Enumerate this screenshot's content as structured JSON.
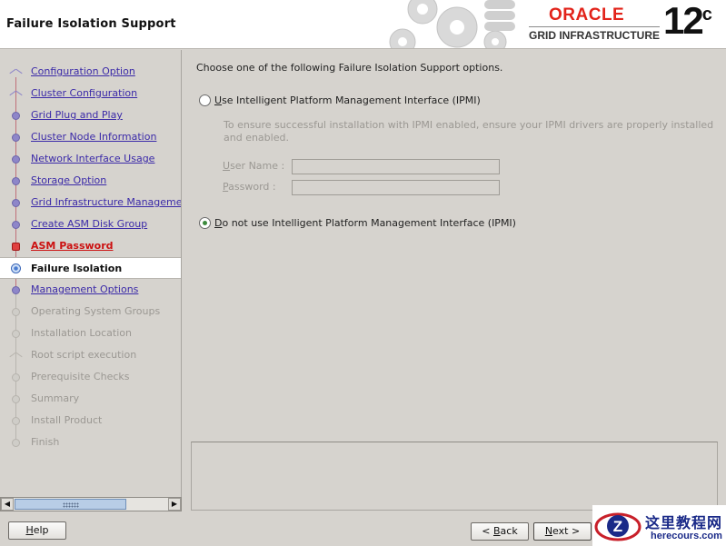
{
  "header": {
    "title": "Failure Isolation Support",
    "brand": "ORACLE",
    "product": "GRID INFRASTRUCTURE",
    "version": "12",
    "version_suffix": "c"
  },
  "nav": {
    "steps": [
      {
        "label": "Configuration Option",
        "state": "done"
      },
      {
        "label": "Cluster Configuration",
        "state": "done"
      },
      {
        "label": "Grid Plug and Play",
        "state": "done"
      },
      {
        "label": "Cluster Node Information",
        "state": "done"
      },
      {
        "label": "Network Interface Usage",
        "state": "done"
      },
      {
        "label": "Storage Option",
        "state": "done"
      },
      {
        "label": "Grid Infrastructure Management",
        "state": "done"
      },
      {
        "label": "Create ASM Disk Group",
        "state": "done"
      },
      {
        "label": "ASM Password",
        "state": "error"
      },
      {
        "label": "Failure Isolation",
        "state": "current"
      },
      {
        "label": "Management Options",
        "state": "next"
      },
      {
        "label": "Operating System Groups",
        "state": "future"
      },
      {
        "label": "Installation Location",
        "state": "future"
      },
      {
        "label": "Root script execution",
        "state": "future"
      },
      {
        "label": "Prerequisite Checks",
        "state": "future"
      },
      {
        "label": "Summary",
        "state": "future"
      },
      {
        "label": "Install Product",
        "state": "future"
      },
      {
        "label": "Finish",
        "state": "future"
      }
    ]
  },
  "main": {
    "intro": "Choose one of the following Failure Isolation Support options.",
    "option_ipmi": {
      "mnemonic": "U",
      "rest": "se Intelligent Platform Management Interface (IPMI)",
      "checked": false
    },
    "ipmi_description": "To ensure successful installation with IPMI enabled, ensure your IPMI drivers are properly installed and enabled.",
    "username_label": "User Name :",
    "username_mnemonic": "U",
    "username_rest": "ser Name :",
    "password_label": "Password :",
    "password_mnemonic": "P",
    "password_rest": "assword :",
    "option_no_ipmi": {
      "mnemonic": "D",
      "rest": "o not use Intelligent Platform Management Interface (IPMI)",
      "checked": true
    }
  },
  "buttons": {
    "help_mnemonic": "H",
    "help_rest": "elp",
    "back_prefix": "< ",
    "back_mnemonic": "B",
    "back_rest": "ack",
    "next_mnemonic": "N",
    "next_rest": "ext >"
  },
  "watermark": {
    "cn": "这里教程网",
    "en": "herecours.com"
  }
}
